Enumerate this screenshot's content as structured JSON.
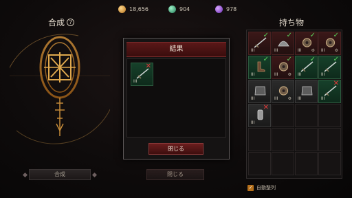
{
  "currency": [
    {
      "icon": "gold-coin-icon",
      "value": "18,656"
    },
    {
      "icon": "green-gem-icon",
      "value": "904"
    },
    {
      "icon": "purple-orb-icon",
      "value": "978"
    }
  ],
  "crafting": {
    "title": "合成",
    "help": "?",
    "button": "合成"
  },
  "modal": {
    "title": "結果",
    "close_button": "閉じる",
    "result_item": {
      "tier": "III",
      "status": "rejected"
    }
  },
  "main_close_button": "閉じる",
  "inventory": {
    "title": "持ち物",
    "auto_sort_label": "自動整列",
    "auto_sort_checked": true,
    "slots": [
      {
        "type": "weapon",
        "style": "filled",
        "status": "ok",
        "tier": "III"
      },
      {
        "type": "helmet",
        "style": "filled",
        "status": "ok",
        "tier": "III"
      },
      {
        "type": "ring",
        "style": "filled",
        "status": "ok",
        "tier": "III",
        "gear": "⚙"
      },
      {
        "type": "ring",
        "style": "filled",
        "status": "ok",
        "tier": "III",
        "gear": "⚙"
      },
      {
        "type": "boots",
        "style": "green",
        "status": "ok",
        "tier": "III"
      },
      {
        "type": "ring",
        "style": "filled",
        "status": "ok",
        "tier": "III",
        "gear": "⚙"
      },
      {
        "type": "weapon",
        "style": "green",
        "status": "ok",
        "tier": "III"
      },
      {
        "type": "weapon",
        "style": "green",
        "status": "ok",
        "tier": "III"
      },
      {
        "type": "armor",
        "style": "grey",
        "status": "none",
        "tier": "III"
      },
      {
        "type": "ring",
        "style": "grey",
        "status": "none",
        "tier": "III",
        "gear": "⚙"
      },
      {
        "type": "armor",
        "style": "grey",
        "status": "none",
        "tier": "III"
      },
      {
        "type": "weapon",
        "style": "green",
        "status": "no",
        "tier": "III"
      },
      {
        "type": "bracer",
        "style": "grey",
        "status": "no",
        "tier": "III"
      },
      {
        "type": "empty",
        "style": "empty"
      },
      {
        "type": "empty",
        "style": "empty"
      },
      {
        "type": "empty",
        "style": "empty"
      },
      {
        "type": "empty",
        "style": "empty"
      },
      {
        "type": "empty",
        "style": "empty"
      },
      {
        "type": "empty",
        "style": "empty"
      },
      {
        "type": "empty",
        "style": "empty"
      },
      {
        "type": "empty",
        "style": "empty"
      },
      {
        "type": "empty",
        "style": "empty"
      },
      {
        "type": "empty",
        "style": "empty"
      },
      {
        "type": "empty",
        "style": "empty"
      }
    ]
  }
}
